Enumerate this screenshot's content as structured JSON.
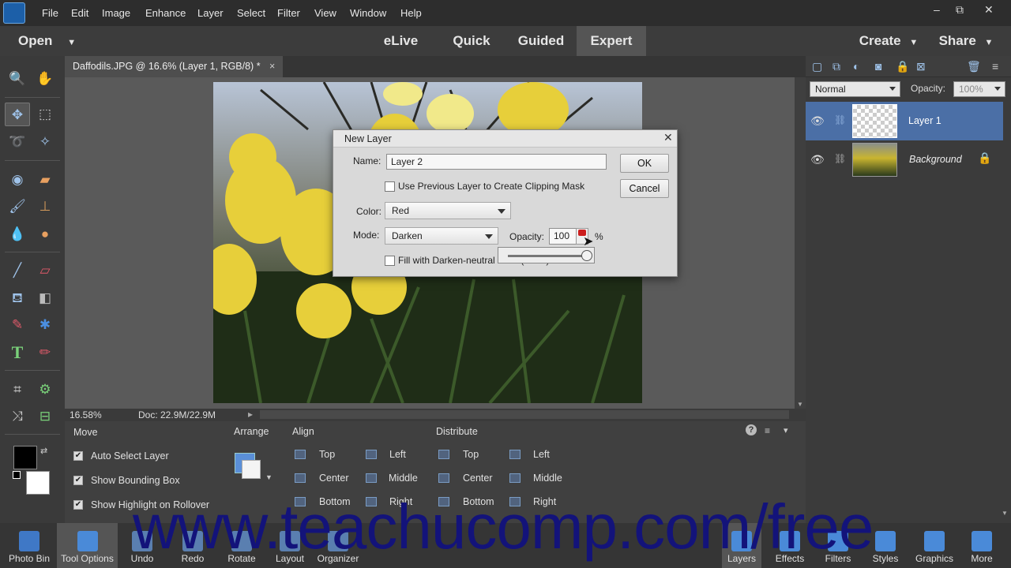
{
  "menubar": {
    "items": [
      "File",
      "Edit",
      "Image",
      "Enhance",
      "Layer",
      "Select",
      "Filter",
      "View",
      "Window",
      "Help"
    ],
    "window_controls": {
      "minimize": "–",
      "restore": "⧉",
      "close": "✕"
    }
  },
  "modebar": {
    "open_label": "Open",
    "modes": [
      "eLive",
      "Quick",
      "Guided",
      "Expert"
    ],
    "active_mode": "Expert",
    "create_label": "Create",
    "share_label": "Share"
  },
  "document": {
    "tab_title": "Daffodils.JPG @ 16.6% (Layer 1, RGB/8) *",
    "tab_close": "×",
    "zoom": "16.58%",
    "doc_size": "Doc: 22.9M/22.9M"
  },
  "dialog": {
    "title": "New Layer",
    "name_label": "Name:",
    "name_value": "Layer 2",
    "clip_label": "Use Previous Layer to Create Clipping Mask",
    "color_label": "Color:",
    "color_value": "Red",
    "mode_label": "Mode:",
    "mode_value": "Darken",
    "opacity_label": "Opacity:",
    "opacity_value": "100",
    "opacity_unit": "%",
    "opacity_slider_level": 1.0,
    "fill_label": "Fill with Darken-neutral color (white)",
    "ok_label": "OK",
    "cancel_label": "Cancel"
  },
  "layers_panel": {
    "blend_mode": "Normal",
    "opacity_label": "Opacity:",
    "opacity_value": "100%",
    "layers": [
      {
        "name": "Layer 1",
        "selected": true
      },
      {
        "name": "Background",
        "selected": false
      }
    ]
  },
  "tool_options": {
    "tool_name": "Move",
    "checkboxes": [
      "Auto Select Layer",
      "Show Bounding Box",
      "Show Highlight on Rollover"
    ],
    "arrange_label": "Arrange",
    "align_label": "Align",
    "align_items": [
      "Top",
      "Center",
      "Bottom",
      "Left",
      "Middle",
      "Right"
    ],
    "distribute_label": "Distribute",
    "distribute_items": [
      "Top",
      "Center",
      "Bottom",
      "Left",
      "Middle",
      "Right"
    ]
  },
  "bottombar": {
    "left_items": [
      "Photo Bin",
      "Tool Options",
      "Undo",
      "Redo",
      "Rotate",
      "Layout",
      "Organizer"
    ],
    "right_items": [
      "Layers",
      "Effects",
      "Filters",
      "Styles",
      "Graphics",
      "More"
    ],
    "selected_left": "Tool Options",
    "selected_right": "Layers"
  },
  "watermark": "www.teachucomp.com/free",
  "colors": {
    "selection_blue": "#4b6fa6",
    "watermark": "#13137a",
    "red_swatch": "#cc1e1e"
  }
}
